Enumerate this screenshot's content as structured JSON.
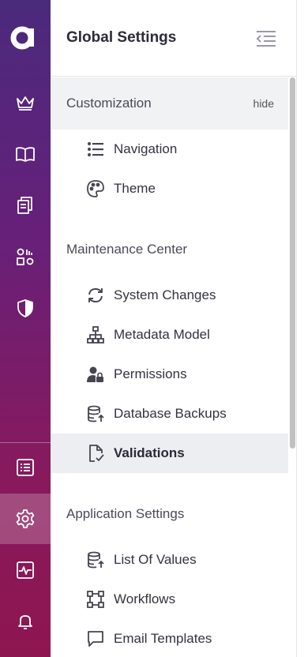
{
  "rail": {
    "logo": "a",
    "items": [
      {
        "icon": "crown-icon"
      },
      {
        "icon": "book-icon"
      },
      {
        "icon": "documents-icon"
      },
      {
        "icon": "shapes-icon"
      },
      {
        "icon": "shield-icon"
      },
      {
        "icon": "list-icon"
      },
      {
        "icon": "gear-icon",
        "active": true
      },
      {
        "icon": "pulse-icon"
      },
      {
        "icon": "bell-icon"
      }
    ]
  },
  "panel": {
    "title": "Global Settings",
    "sections": [
      {
        "label": "Customization",
        "hide_label": "hide",
        "items": [
          {
            "label": "Navigation",
            "icon": "list-bullets-icon"
          },
          {
            "label": "Theme",
            "icon": "palette-icon"
          }
        ]
      },
      {
        "label": "Maintenance Center",
        "items": [
          {
            "label": "System Changes",
            "icon": "sync-icon"
          },
          {
            "label": "Metadata Model",
            "icon": "sitemap-icon"
          },
          {
            "label": "Permissions",
            "icon": "user-lock-icon"
          },
          {
            "label": "Database Backups",
            "icon": "database-upload-icon"
          },
          {
            "label": "Validations",
            "icon": "file-check-icon",
            "selected": true
          }
        ]
      },
      {
        "label": "Application Settings",
        "items": [
          {
            "label": "List Of Values",
            "icon": "database-values-icon"
          },
          {
            "label": "Workflows",
            "icon": "workflow-icon"
          },
          {
            "label": "Email Templates",
            "icon": "comment-icon"
          }
        ]
      }
    ]
  },
  "colors": {
    "rail_top": "#4a2a7c",
    "rail_bottom": "#8e1650",
    "section_bg": "#f1f2f4",
    "selected_bg": "#eceef1"
  }
}
